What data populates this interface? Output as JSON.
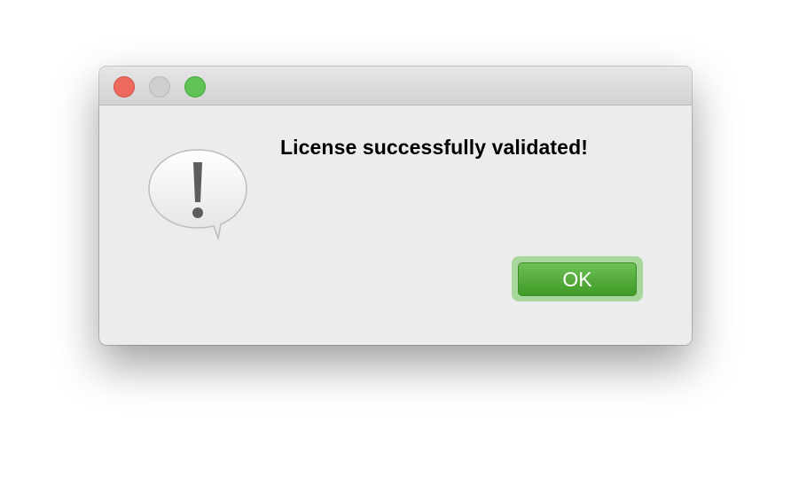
{
  "dialog": {
    "message": "License successfully validated!",
    "ok_label": "OK"
  },
  "icons": {
    "alert": "exclamation-speech-bubble-icon"
  },
  "colors": {
    "close": "#ee6a5e",
    "minimize": "#cfcfcf",
    "zoom": "#5fc454",
    "ok_button": "#4ea934"
  }
}
